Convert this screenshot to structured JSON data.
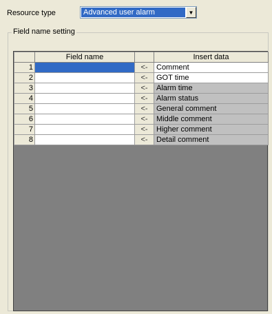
{
  "resource": {
    "label": "Resource type",
    "value": "Advanced user alarm"
  },
  "group": {
    "title": "Field name setting"
  },
  "table": {
    "headers": [
      "",
      "Field name",
      "",
      "Insert data"
    ],
    "rows": [
      {
        "num": "1",
        "field": "",
        "arrow": "<-",
        "insert": "Comment"
      },
      {
        "num": "2",
        "field": "",
        "arrow": "<-",
        "insert": "GOT time"
      },
      {
        "num": "3",
        "field": "",
        "arrow": "<-",
        "insert": "Alarm time"
      },
      {
        "num": "4",
        "field": "",
        "arrow": "<-",
        "insert": "Alarm status"
      },
      {
        "num": "5",
        "field": "",
        "arrow": "<-",
        "insert": "General comment"
      },
      {
        "num": "6",
        "field": "",
        "arrow": "<-",
        "insert": "Middle comment"
      },
      {
        "num": "7",
        "field": "",
        "arrow": "<-",
        "insert": "Higher comment"
      },
      {
        "num": "8",
        "field": "",
        "arrow": "<-",
        "insert": "Detail comment"
      }
    ]
  },
  "colors": {
    "selection": "#316ac5",
    "window": "#ece9d8",
    "grid_empty": "#808080",
    "insert_disabled": "#c0c0c0"
  },
  "icons": {
    "dropdown": "chevron-down-icon"
  }
}
